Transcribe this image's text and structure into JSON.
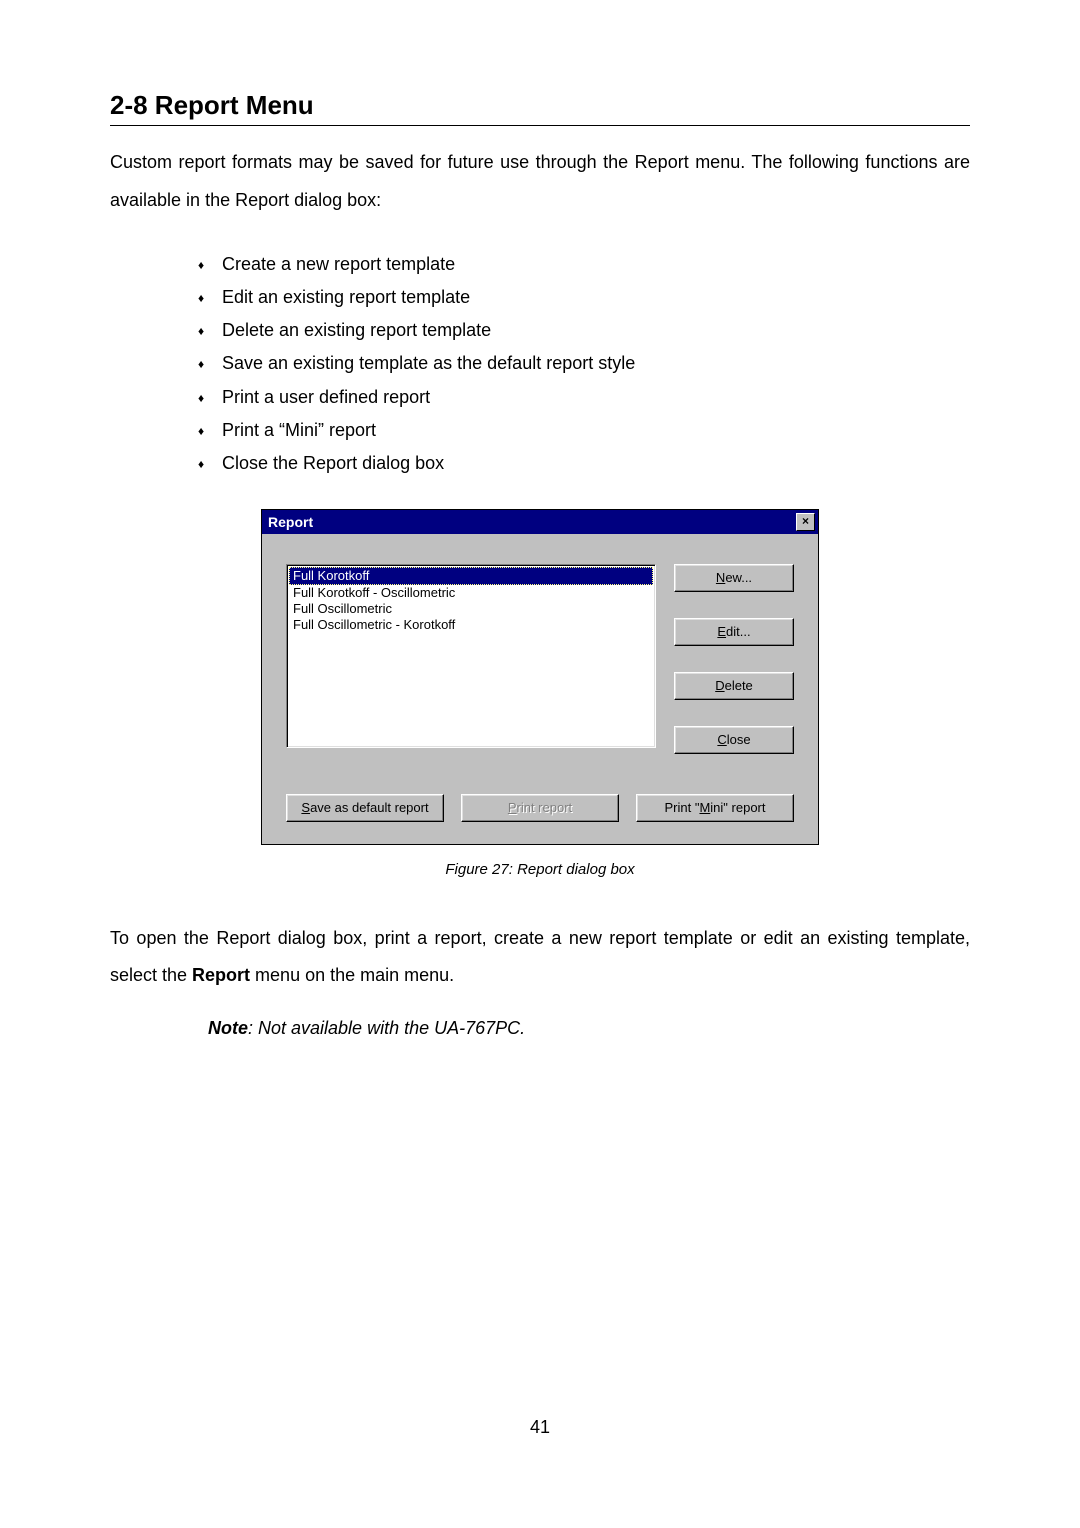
{
  "section": {
    "title": "2-8 Report Menu",
    "intro": "Custom report formats may be saved for future use through the Report menu. The following functions are available in the Report dialog box:",
    "bullets": [
      "Create a new report template",
      "Edit an existing report template",
      "Delete an existing report template",
      "Save an existing template as the default report style",
      "Print a user defined report",
      "Print a “Mini” report",
      "Close the Report dialog box"
    ],
    "outro_pre": "To open the Report dialog box, print a report, create a new report template or edit an existing template, select the ",
    "outro_bold": "Report",
    "outro_post": " menu on the main menu.",
    "note_label": "Note",
    "note_text": ": Not available with the UA-767PC."
  },
  "dialog": {
    "title": "Report",
    "close_glyph": "×",
    "list_items": [
      "Full Korotkoff",
      "Full Korotkoff - Oscillometric",
      "Full Oscillometric",
      "Full Oscillometric - Korotkoff"
    ],
    "side_buttons": {
      "new": {
        "accel": "N",
        "rest": "ew...",
        "disabled": false
      },
      "edit": {
        "accel": "E",
        "rest": "dit...",
        "disabled": false
      },
      "del": {
        "accel": "D",
        "rest": "elete",
        "disabled": false
      },
      "close": {
        "accel": "C",
        "rest": "lose",
        "disabled": false
      }
    },
    "bottom_buttons": {
      "save_default": {
        "accel": "S",
        "pre": "",
        "rest": "ave as default report",
        "disabled": false
      },
      "print_report": {
        "accel": "P",
        "pre": "",
        "rest": "rint report",
        "disabled": true
      },
      "print_mini": {
        "pre": "Print \"",
        "accel": "M",
        "rest": "ini\" report",
        "disabled": false
      }
    }
  },
  "figure_caption": "Figure 27: Report dialog box",
  "page_number": "41"
}
